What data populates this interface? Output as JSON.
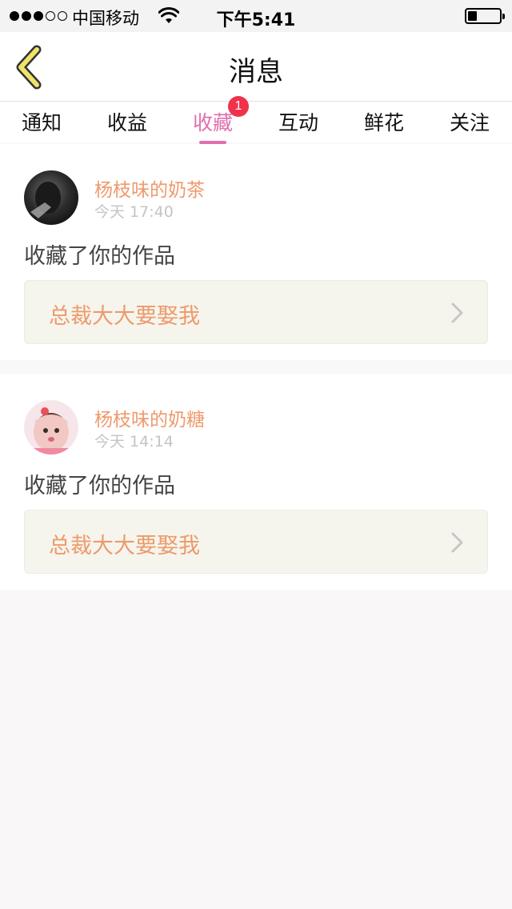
{
  "status_bar": {
    "carrier": "中国移动",
    "time": "下午5:41",
    "signal_bars_filled": 3,
    "signal_bars_total": 5,
    "battery_level": 0.3
  },
  "nav": {
    "title": "消息",
    "back_icon": "chevron-left-icon"
  },
  "tabs": [
    {
      "label": "通知"
    },
    {
      "label": "收益"
    },
    {
      "label": "收藏",
      "active": true,
      "badge": "1"
    },
    {
      "label": "互动"
    },
    {
      "label": "鲜花"
    },
    {
      "label": "关注"
    }
  ],
  "messages": [
    {
      "username": "杨枝味的奶茶",
      "time": "今天 17:40",
      "action": "收藏了你的作品",
      "work_title": "总裁大大要娶我"
    },
    {
      "username": "杨枝味的奶糖",
      "time": "今天 14:14",
      "action": "收藏了你的作品",
      "work_title": "总裁大大要娶我"
    }
  ],
  "colors": {
    "accent": "#e06fae",
    "name": "#ee9a6c",
    "badge": "#f0324a",
    "back_icon": "#f0e36a"
  }
}
